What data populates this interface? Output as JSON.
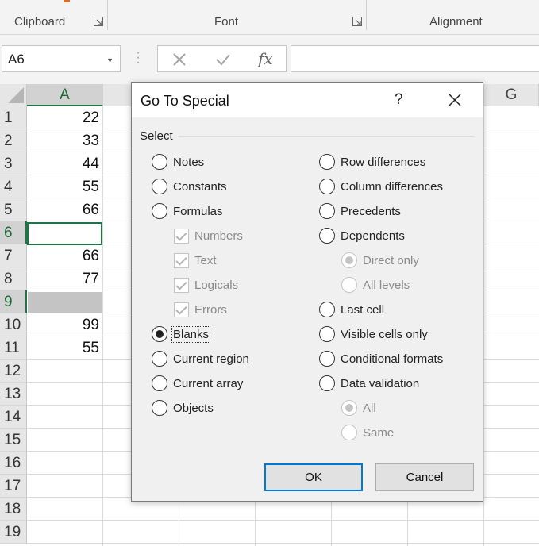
{
  "ribbon": {
    "groups": [
      {
        "label": "Clipboard"
      },
      {
        "label": "Font"
      },
      {
        "label": "Alignment"
      }
    ]
  },
  "formula_bar": {
    "name_box": "A6",
    "cancel_icon": "cancel-icon",
    "enter_icon": "checkmark-icon",
    "function_label": "fx",
    "formula_value": ""
  },
  "sheet": {
    "columns": [
      "A",
      "G"
    ],
    "selected_column": "A",
    "active_cell": "A6",
    "rows": [
      {
        "row": "1",
        "a": "22"
      },
      {
        "row": "2",
        "a": "33"
      },
      {
        "row": "3",
        "a": "44"
      },
      {
        "row": "4",
        "a": "55"
      },
      {
        "row": "5",
        "a": "66"
      },
      {
        "row": "6",
        "a": ""
      },
      {
        "row": "7",
        "a": "66"
      },
      {
        "row": "8",
        "a": "77"
      },
      {
        "row": "9",
        "a": ""
      },
      {
        "row": "10",
        "a": "99"
      },
      {
        "row": "11",
        "a": "55"
      },
      {
        "row": "12",
        "a": ""
      },
      {
        "row": "13",
        "a": ""
      },
      {
        "row": "14",
        "a": ""
      },
      {
        "row": "15",
        "a": ""
      },
      {
        "row": "16",
        "a": ""
      },
      {
        "row": "17",
        "a": ""
      },
      {
        "row": "18",
        "a": ""
      },
      {
        "row": "19",
        "a": ""
      }
    ]
  },
  "dialog": {
    "title": "Go To Special",
    "help": "?",
    "group_label": "Select",
    "left_options": [
      {
        "label": "Notes",
        "checked": false
      },
      {
        "label": "Constants",
        "checked": false
      },
      {
        "label": "Formulas",
        "checked": false
      },
      {
        "label": "Blanks",
        "checked": true
      },
      {
        "label": "Current region",
        "checked": false
      },
      {
        "label": "Current array",
        "checked": false
      },
      {
        "label": "Objects",
        "checked": false
      }
    ],
    "formula_suboptions": [
      {
        "label": "Numbers",
        "checked": true,
        "enabled": false
      },
      {
        "label": "Text",
        "checked": true,
        "enabled": false
      },
      {
        "label": "Logicals",
        "checked": true,
        "enabled": false
      },
      {
        "label": "Errors",
        "checked": true,
        "enabled": false
      }
    ],
    "right_options": [
      {
        "label": "Row differences",
        "checked": false
      },
      {
        "label": "Column differences",
        "checked": false
      },
      {
        "label": "Precedents",
        "checked": false
      },
      {
        "label": "Dependents",
        "checked": false
      },
      {
        "label": "Last cell",
        "checked": false
      },
      {
        "label": "Visible cells only",
        "checked": false
      },
      {
        "label": "Conditional formats",
        "checked": false
      },
      {
        "label": "Data validation",
        "checked": false
      }
    ],
    "dependents_suboptions": [
      {
        "label": "Direct only",
        "checked": true,
        "enabled": false
      },
      {
        "label": "All levels",
        "checked": false,
        "enabled": false
      }
    ],
    "validation_suboptions": [
      {
        "label": "All",
        "checked": true,
        "enabled": false
      },
      {
        "label": "Same",
        "checked": false,
        "enabled": false
      }
    ],
    "ok_label": "OK",
    "cancel_label": "Cancel"
  },
  "colors": {
    "excel_green": "#217346",
    "focus_blue": "#0078d7",
    "selection_gray": "#c4c4c4"
  }
}
